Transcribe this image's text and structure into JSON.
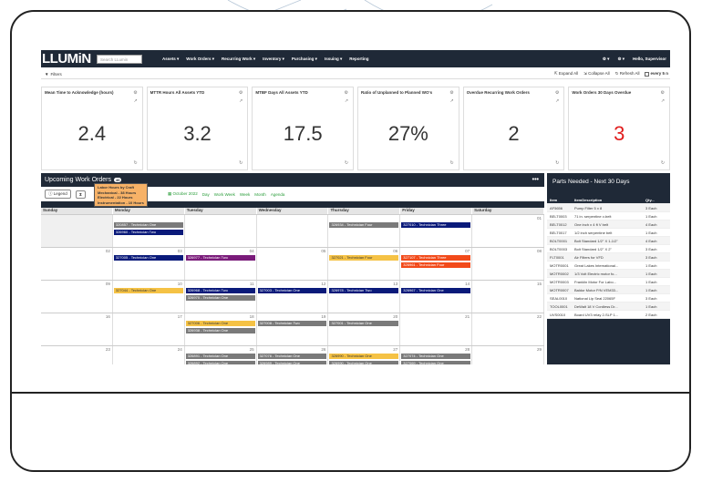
{
  "nav": {
    "logo": "LLUMiN",
    "search_placeholder": "Search LLumin",
    "items": [
      "Assets ▾",
      "Work Orders ▾",
      "Recurring Work ▾",
      "Inventory ▾",
      "Purchasing ▾",
      "Issuing ▾",
      "Reporting"
    ],
    "right": [
      "⚙ ▾",
      "⚙ ▾",
      "Hello, Supervisor"
    ]
  },
  "filterbar": {
    "filters": "Filters",
    "expand": "Expand All",
    "collapse": "Collapse All",
    "refresh": "Refresh All",
    "every": "every 5 n"
  },
  "kpis": [
    {
      "title": "Mean Time to Acknowledge (hours)",
      "value": "2.4",
      "color": "#333333"
    },
    {
      "title": "MTTR Hours All Assets YTD",
      "value": "3.2",
      "color": "#333333"
    },
    {
      "title": "MTBF Days All Assets YTD",
      "value": "17.5",
      "color": "#333333"
    },
    {
      "title": "Ratio of Unplanned to Planned WO's",
      "value": "27%",
      "color": "#333333"
    },
    {
      "title": "Overdue Recurring Work Orders",
      "value": "2",
      "color": "#333333"
    },
    {
      "title": "Work Orders 30 Days Overdue",
      "value": "3",
      "color": "#e11d1d"
    }
  ],
  "workorders": {
    "title": "Upcoming Work Orders",
    "count": "46",
    "legend": "Legend",
    "month": "October 2022",
    "views": [
      "Day",
      "Work Week",
      "Week",
      "Month",
      "Agenda"
    ],
    "tooltip": [
      "Labor Hours by Craft",
      "Mechanical - 38 Hours",
      "Electrical - 22 Hours",
      "Instrumentation - 10 Hours"
    ],
    "days": [
      "Sunday",
      "Monday",
      "Tuesday",
      "Wednesday",
      "Thursday",
      "Friday",
      "Saturday"
    ],
    "weeks": [
      {
        "nums": [
          "",
          "",
          "",
          "",
          "",
          "",
          "01"
        ],
        "events": [
          [],
          [
            {
              "t": "320857 - Technician One",
              "c": "grey"
            },
            {
              "t": "326960 - Technician Two",
              "c": "navy"
            }
          ],
          [],
          [],
          [
            {
              "t": "326934 - Technician Four",
              "c": "grey"
            }
          ],
          [
            {
              "t": "327010 - Technician Three",
              "c": "navy"
            }
          ],
          []
        ]
      },
      {
        "nums": [
          "02",
          "03",
          "04",
          "05",
          "06",
          "07",
          "08"
        ],
        "events": [
          [],
          [
            {
              "t": "327005 - Technician One",
              "c": "navy"
            }
          ],
          [
            {
              "t": "326977 - Technician Two",
              "c": "purple"
            }
          ],
          [],
          [
            {
              "t": "327021 - Technician Four",
              "c": "yellow"
            }
          ],
          [
            {
              "t": "327107 - Technician Three",
              "c": "orange"
            },
            {
              "t": "326961 - Technician Four",
              "c": "orange"
            }
          ],
          []
        ]
      },
      {
        "nums": [
          "09",
          "10",
          "11",
          "12",
          "13",
          "14",
          "15"
        ],
        "events": [
          [],
          [
            {
              "t": "327044 - Technician One",
              "c": "yellow"
            }
          ],
          [
            {
              "t": "326968 - Technician Two",
              "c": "navy"
            },
            {
              "t": "326970 - Technician One",
              "c": "grey"
            }
          ],
          [
            {
              "t": "327003 - Technician One",
              "c": "navy"
            }
          ],
          [
            {
              "t": "326978 - Technician Two",
              "c": "navy"
            }
          ],
          [
            {
              "t": "326967 - Technician One",
              "c": "navy"
            }
          ],
          []
        ]
      },
      {
        "nums": [
          "16",
          "17",
          "18",
          "19",
          "20",
          "21",
          "22"
        ],
        "events": [
          [],
          [],
          [
            {
              "t": "327006 - Technician One",
              "c": "yellow"
            },
            {
              "t": "326938 - Technician One",
              "c": "grey"
            }
          ],
          [
            {
              "t": "327008 - Technician Two",
              "c": "grey"
            }
          ],
          [
            {
              "t": "327001 - Technician One",
              "c": "grey"
            }
          ],
          [],
          []
        ]
      },
      {
        "nums": [
          "23",
          "24",
          "25",
          "26",
          "27",
          "28",
          "29"
        ],
        "events": [
          [],
          [],
          [
            {
              "t": "326891 - Technician One",
              "c": "grey"
            },
            {
              "t": "326892 - Technician One",
              "c": "grey"
            }
          ],
          [
            {
              "t": "327076 - Technician One",
              "c": "grey"
            },
            {
              "t": "326989 - Technician One",
              "c": "grey"
            }
          ],
          [
            {
              "t": "326990 - Technician One",
              "c": "yellow"
            },
            {
              "t": "326990 - Technician One",
              "c": "grey"
            }
          ],
          [
            {
              "t": "327074 - Technician One",
              "c": "grey"
            },
            {
              "t": "327069 - Technician One",
              "c": "grey"
            }
          ],
          []
        ]
      }
    ]
  },
  "parts": {
    "title": "Parts Needed - Next 30 Days",
    "headers": [
      "Item",
      "ItemDescription",
      "Qty..."
    ],
    "rows": [
      [
        "AF5656",
        "Pump Filter 5 x 8",
        "3 Each"
      ],
      [
        "BELT0003",
        "71 in. serpentine v-belt",
        "1 Each"
      ],
      [
        "BELT0012",
        "One inch x 4 ft V belt",
        "4 Each"
      ],
      [
        "BELT0017",
        "1/2 inch serpentine belt",
        "1 Each"
      ],
      [
        "BOLT0001",
        "Bolt Standard 1/2\" X 1-1/2\"",
        "4 Each"
      ],
      [
        "BOLT0003",
        "Bolt Standard 1/2\" X 2\"",
        "3 Each"
      ],
      [
        "FLT0001",
        "Air Filters for VFD",
        "3 Each"
      ],
      [
        "MOTR0001",
        "Great Lakes International...",
        "1 Each"
      ],
      [
        "MOTR0002",
        "1/3 Volt Electric motor fo...",
        "1 Each"
      ],
      [
        "MOTR0003",
        "Franklin Motor For Labo...",
        "1 Each"
      ],
      [
        "MOTR0007",
        "Baldor Motor P/N VEM33...",
        "1 Each"
      ],
      [
        "SEAL0010",
        "National Lip Seal 22065F",
        "3 Each"
      ],
      [
        "TOOL0001",
        "DeWalt 18 V Cordless Dr...",
        "1 Each"
      ],
      [
        "UVS0010",
        "Board UV3 relay 2-SLP 1...",
        "2 Each"
      ]
    ]
  }
}
